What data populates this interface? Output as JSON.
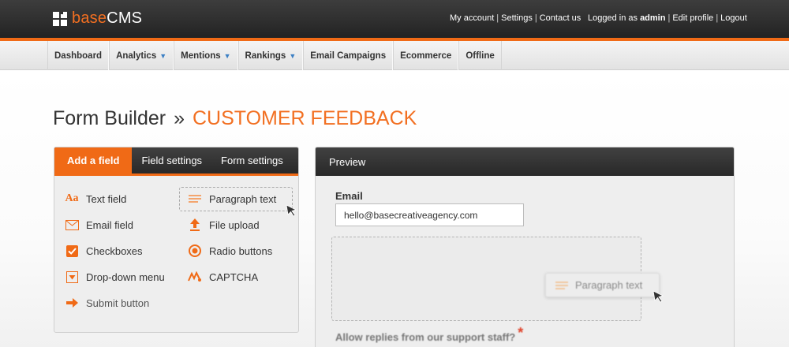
{
  "app": {
    "logo_prefix": "base",
    "logo_suffix": "CMS"
  },
  "header": {
    "my_account": "My account",
    "settings": "Settings",
    "contact_us": "Contact us",
    "logged_in_prefix": "Logged in as",
    "username": "admin",
    "edit_profile": "Edit profile",
    "logout": "Logout",
    "separator": "|"
  },
  "nav": {
    "items": [
      {
        "label": "Dashboard",
        "has_dropdown": false
      },
      {
        "label": "Analytics",
        "has_dropdown": true
      },
      {
        "label": "Mentions",
        "has_dropdown": true
      },
      {
        "label": "Rankings",
        "has_dropdown": true
      },
      {
        "label": "Email Campaigns",
        "has_dropdown": false
      },
      {
        "label": "Ecommerce",
        "has_dropdown": false
      },
      {
        "label": "Offline",
        "has_dropdown": false
      }
    ],
    "dropdown_glyph": "⌄"
  },
  "page": {
    "breadcrumb_root": "Form Builder",
    "breadcrumb_separator": "»",
    "form_name": "CUSTOMER FEEDBACK"
  },
  "builder": {
    "tabs": [
      {
        "label": "Add a field",
        "active": true
      },
      {
        "label": "Field settings",
        "active": false
      },
      {
        "label": "Form settings",
        "active": false
      }
    ],
    "fields": [
      {
        "label": "Text field",
        "icon": "text-field-icon"
      },
      {
        "label": "Paragraph text",
        "icon": "paragraph-icon"
      },
      {
        "label": "Email field",
        "icon": "envelope-icon"
      },
      {
        "label": "File upload",
        "icon": "upload-arrow-icon"
      },
      {
        "label": "Checkboxes",
        "icon": "checkbox-icon"
      },
      {
        "label": "Radio buttons",
        "icon": "radio-icon"
      },
      {
        "label": "Drop-down menu",
        "icon": "dropdown-icon"
      },
      {
        "label": "CAPTCHA",
        "icon": "captcha-icon"
      },
      {
        "label": "Submit button",
        "icon": "arrow-right-icon"
      }
    ]
  },
  "preview": {
    "header": "Preview",
    "email_label": "Email",
    "email_value": "hello@basecreativeagency.com",
    "drag_ghost_label": "Paragraph text",
    "question_label": "Allow replies from our support staff?",
    "required_mark": "*"
  },
  "colors": {
    "accent": "#f06a16",
    "topbar": "#2e2e2e",
    "link_chevron": "#3b7fc4"
  }
}
